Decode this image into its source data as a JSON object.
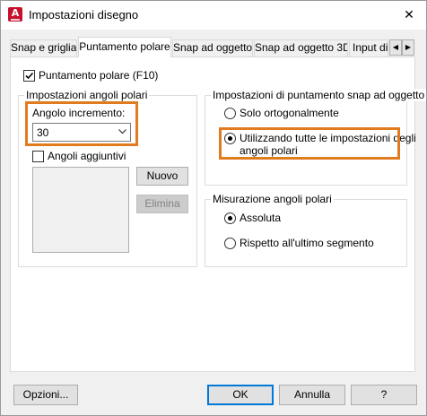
{
  "window": {
    "title": "Impostazioni disegno",
    "app_icon_letter": "A",
    "close_glyph": "✕"
  },
  "tabs": [
    {
      "label": "Snap e griglia",
      "active": false
    },
    {
      "label": "Puntamento polare",
      "active": true
    },
    {
      "label": "Snap ad oggetto",
      "active": false
    },
    {
      "label": "Snap ad oggetto 3D",
      "active": false
    },
    {
      "label": "Input dina",
      "active": false
    }
  ],
  "tab_scroll": {
    "left": "◀",
    "right": "▶"
  },
  "polar": {
    "enable_label": "Puntamento polare (F10)",
    "enable_checked": true,
    "angles_group": {
      "title": "Impostazioni angoli polari",
      "increment_label": "Angolo incremento:",
      "increment_value": "30",
      "additional_label": "Angoli aggiuntivi",
      "additional_checked": false,
      "new_button": "Nuovo",
      "delete_button": "Elimina"
    },
    "snap_group": {
      "title": "Impostazioni di puntamento snap ad oggetto",
      "option_orthogonal": "Solo ortogonalmente",
      "option_all_line1": "Utilizzando tutte le impostazioni degli",
      "option_all_line2": "angoli polari",
      "selected": "all"
    },
    "measure_group": {
      "title": "Misurazione angoli polari",
      "option_absolute": "Assoluta",
      "option_relative": "Rispetto all'ultimo segmento",
      "selected": "absolute"
    }
  },
  "footer": {
    "options_button": "Opzioni...",
    "ok_button": "OK",
    "cancel_button": "Annulla",
    "help_button": "?"
  },
  "colors": {
    "highlight": "#e07b1f",
    "accent": "#0078d7",
    "app_icon": "#c8102e"
  }
}
